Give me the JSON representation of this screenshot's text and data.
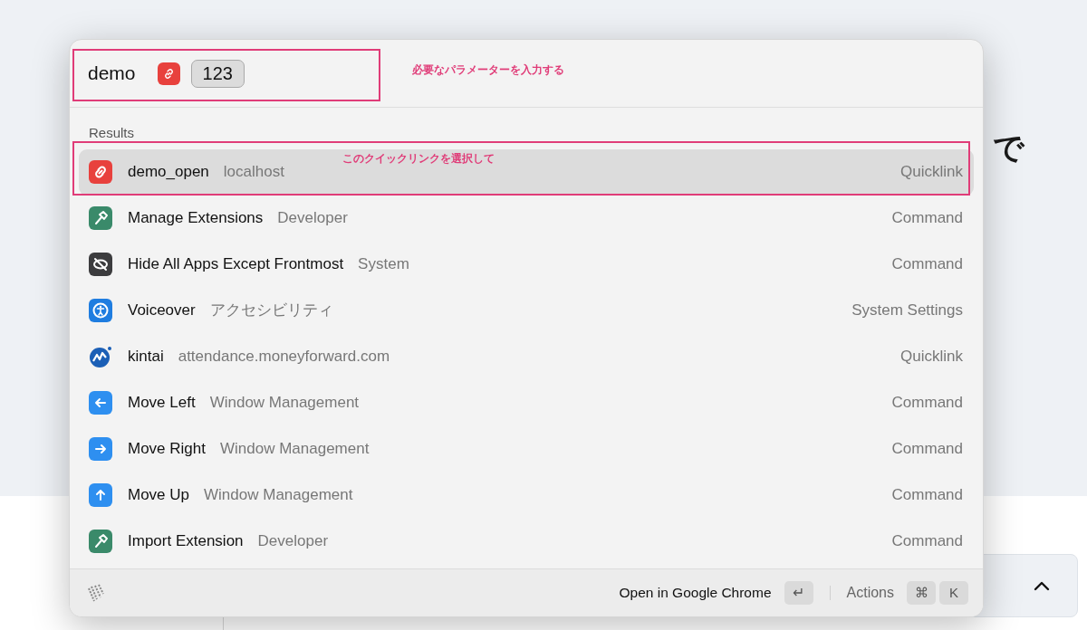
{
  "background": {
    "heading_fragment": "で"
  },
  "search": {
    "query": "demo",
    "argument_value": "123"
  },
  "annotations": [
    {
      "text": "必要なパラメーターを入力する"
    },
    {
      "text": "このクイックリンクを選択して"
    }
  ],
  "results": {
    "heading": "Results",
    "items": [
      {
        "title": "demo_open",
        "subtitle": "localhost",
        "type": "Quicklink",
        "selected": true
      },
      {
        "title": "Manage Extensions",
        "subtitle": "Developer",
        "type": "Command",
        "selected": false
      },
      {
        "title": "Hide All Apps Except Frontmost",
        "subtitle": "System",
        "type": "Command",
        "selected": false
      },
      {
        "title": "Voiceover",
        "subtitle": "アクセシビリティ",
        "type": "System Settings",
        "selected": false
      },
      {
        "title": "kintai",
        "subtitle": "attendance.moneyforward.com",
        "type": "Quicklink",
        "selected": false
      },
      {
        "title": "Move Left",
        "subtitle": "Window Management",
        "type": "Command",
        "selected": false
      },
      {
        "title": "Move Right",
        "subtitle": "Window Management",
        "type": "Command",
        "selected": false
      },
      {
        "title": "Move Up",
        "subtitle": "Window Management",
        "type": "Command",
        "selected": false
      },
      {
        "title": "Import Extension",
        "subtitle": "Developer",
        "type": "Command",
        "selected": false
      }
    ]
  },
  "footer": {
    "primary_action": "Open in Google Chrome",
    "primary_key": "↵",
    "actions_label": "Actions",
    "action_keys": [
      "⌘",
      "K"
    ]
  }
}
